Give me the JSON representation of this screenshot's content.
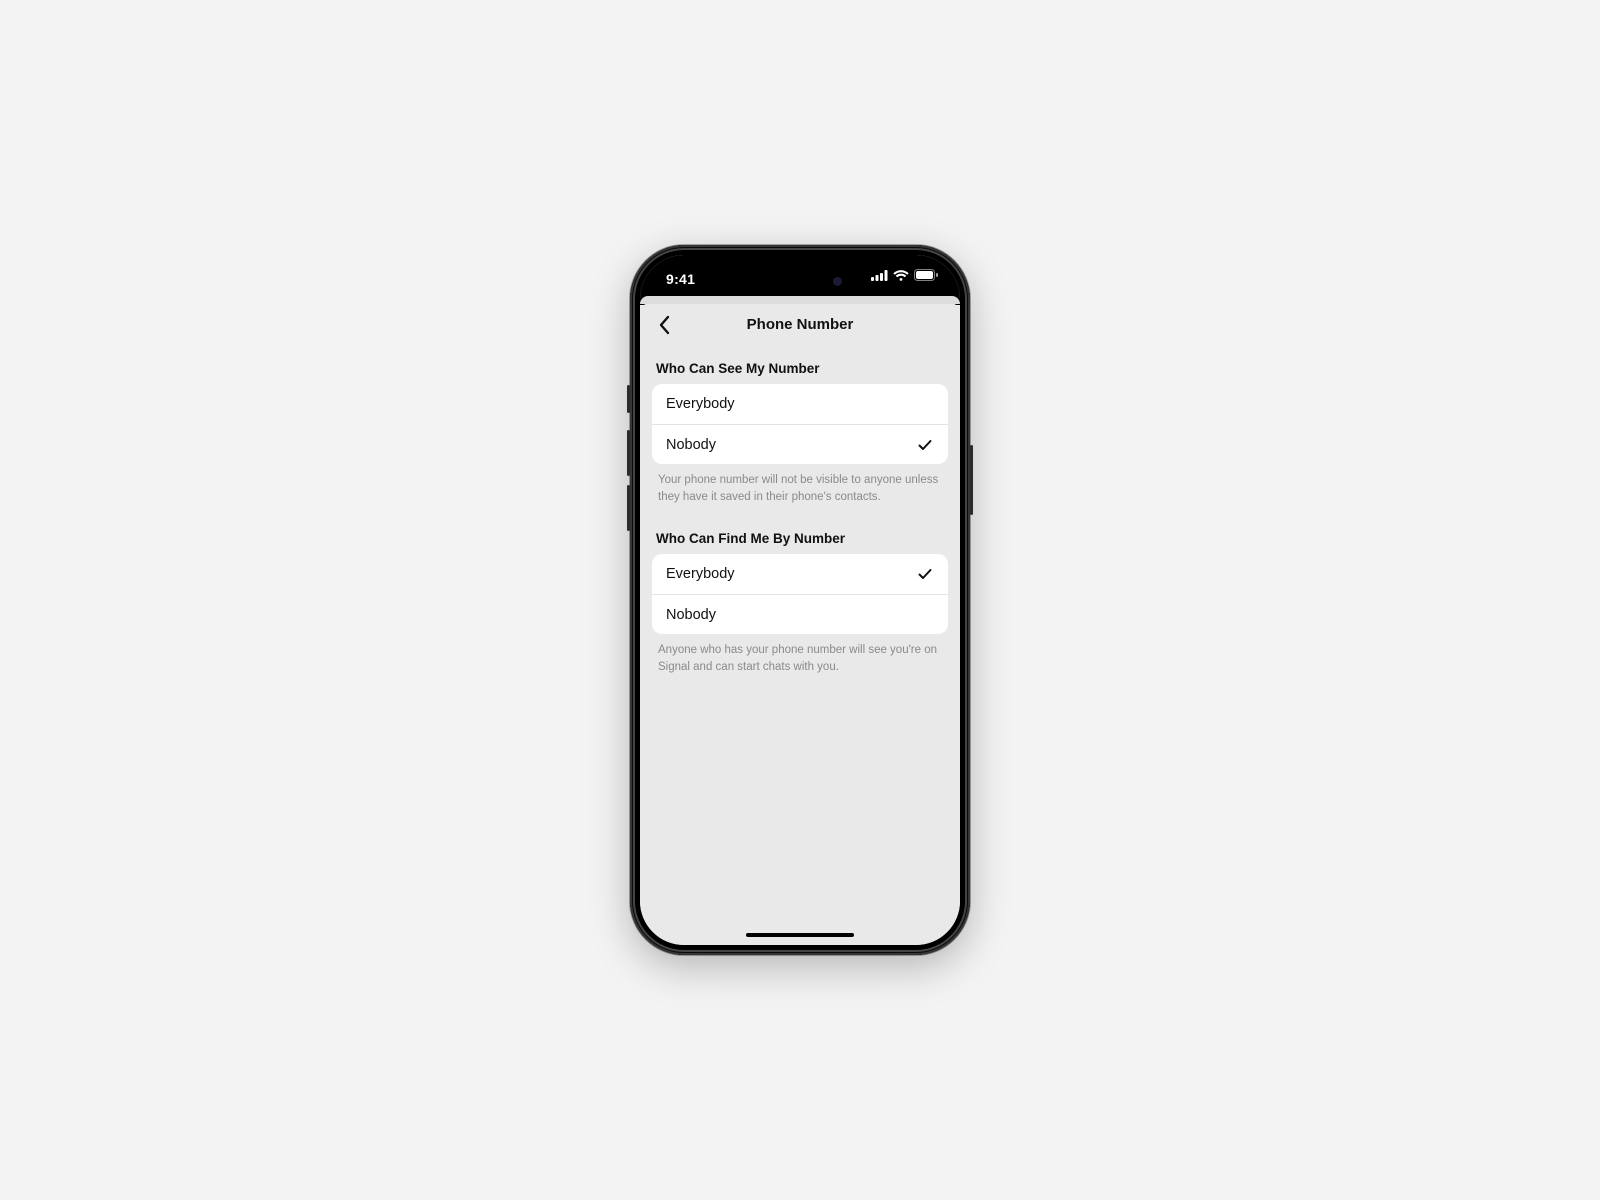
{
  "status": {
    "time": "9:41"
  },
  "nav": {
    "title": "Phone Number"
  },
  "sections": {
    "see": {
      "header": "Who Can See My Number",
      "options": [
        {
          "label": "Everybody",
          "selected": false
        },
        {
          "label": "Nobody",
          "selected": true
        }
      ],
      "footer": "Your phone number will not be visible to anyone unless they have it saved in their phone's contacts."
    },
    "find": {
      "header": "Who Can Find Me By Number",
      "options": [
        {
          "label": "Everybody",
          "selected": true
        },
        {
          "label": "Nobody",
          "selected": false
        }
      ],
      "footer": "Anyone who has your phone number will see you're on Signal and can start chats with you."
    }
  }
}
